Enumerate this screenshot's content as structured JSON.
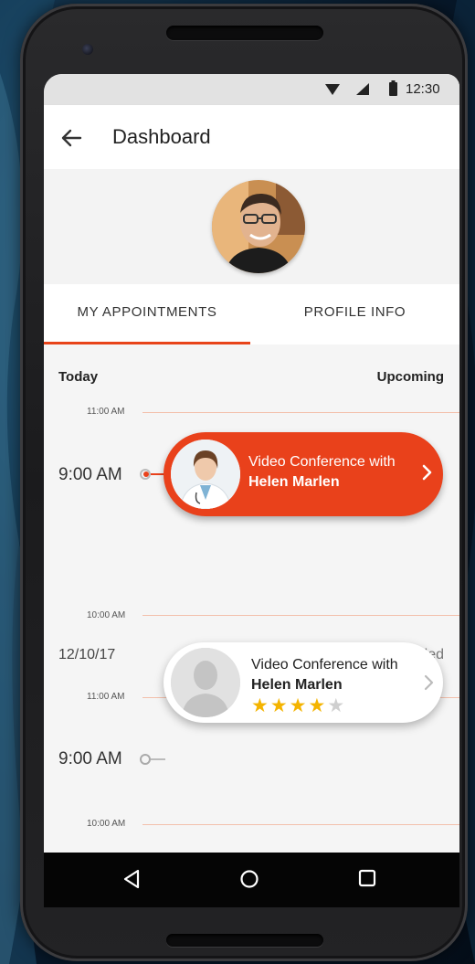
{
  "status_bar": {
    "time": "12:30"
  },
  "app_bar": {
    "title": "Dashboard"
  },
  "tabs": [
    {
      "label": "MY APPOINTMENTS",
      "active": true
    },
    {
      "label": "PROFILE INFO",
      "active": false
    }
  ],
  "sections": [
    {
      "left": "Today",
      "right": "Upcoming",
      "ticks": [
        "11:00 AM",
        "10:00 AM"
      ],
      "time": "9:00 AM",
      "appointment": {
        "line1": "Video Conference with",
        "name": "Helen Marlen"
      }
    },
    {
      "left": "12/10/17",
      "right": "Ended",
      "ticks": [
        "11:00 AM",
        "10:00 AM"
      ],
      "time": "9:00 AM",
      "appointment": {
        "line1": "Video Conference with",
        "name": "Helen Marlen",
        "rating": 4,
        "rating_max": 5
      }
    }
  ],
  "colors": {
    "accent": "#e9411b",
    "star": "#f4b400"
  },
  "icons": [
    "back-arrow-icon",
    "wifi-icon",
    "signal-icon",
    "battery-icon",
    "chevron-right-icon",
    "nav-back-icon",
    "nav-home-icon",
    "nav-recent-icon"
  ]
}
